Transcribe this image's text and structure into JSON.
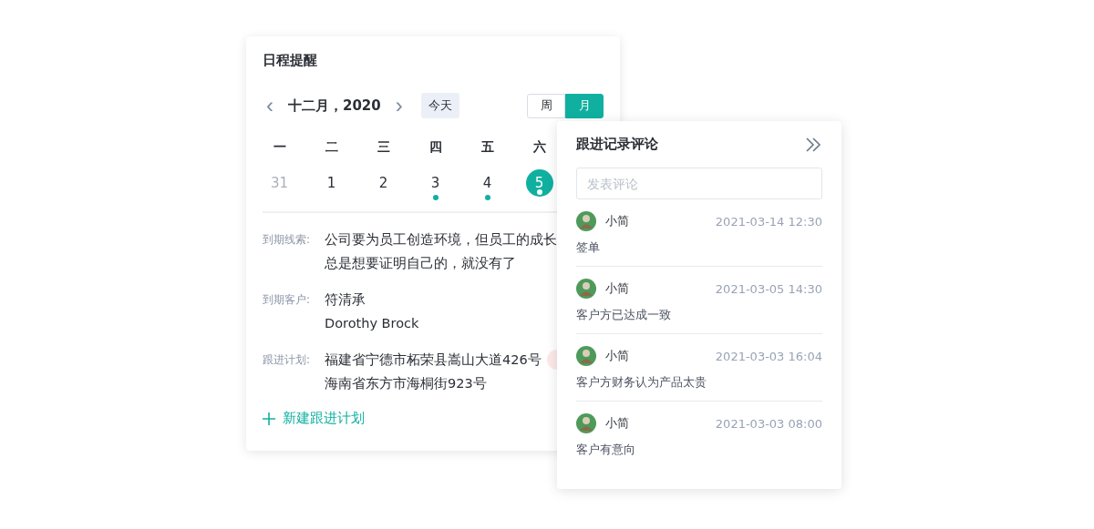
{
  "schedule": {
    "title": "日程提醒",
    "prev": "‹",
    "month": "十二月，2020",
    "next": "›",
    "today_button": "今天",
    "view_toggle": [
      {
        "label": "周",
        "selected": false
      },
      {
        "label": "月",
        "selected": true
      }
    ],
    "weekdays": [
      "一",
      "二",
      "三",
      "四",
      "五",
      "六"
    ],
    "days": [
      {
        "label": "31",
        "other_month": true,
        "has_event": false,
        "selected": false
      },
      {
        "label": "1",
        "other_month": false,
        "has_event": false,
        "selected": false
      },
      {
        "label": "2",
        "other_month": false,
        "has_event": false,
        "selected": false
      },
      {
        "label": "3",
        "other_month": false,
        "has_event": true,
        "selected": false
      },
      {
        "label": "4",
        "other_month": false,
        "has_event": true,
        "selected": false
      },
      {
        "label": "5",
        "other_month": false,
        "has_event": true,
        "selected": true
      }
    ],
    "fields": [
      {
        "label": "到期线索:",
        "lines": [
          "公司要为员工创造环境，但员工的成长",
          "总是想要证明自己的，就没有了"
        ],
        "tag": false
      },
      {
        "label": "到期客户:",
        "lines": [
          "符清承",
          "Dorothy Brock"
        ],
        "tag": false
      },
      {
        "label": "跟进计划:",
        "lines": [
          "福建省宁德市柘荣县嵩山大道426号",
          "海南省东方市海桐街923号"
        ],
        "tag": true
      }
    ],
    "add_link": "新建跟进计划"
  },
  "comments_panel": {
    "title": "跟进记录评论",
    "input": {
      "placeholder": "发表评论"
    },
    "comments": [
      {
        "author": "小简",
        "time": "2021-03-14 12:30",
        "text": "签单"
      },
      {
        "author": "小简",
        "time": "2021-03-05 14:30",
        "text": "客户方已达成一致"
      },
      {
        "author": "小简",
        "time": "2021-03-03 16:04",
        "text": "客户方财务认为产品太贵"
      },
      {
        "author": "小简",
        "time": "2021-03-03 08:00",
        "text": "客户有意向"
      }
    ]
  }
}
